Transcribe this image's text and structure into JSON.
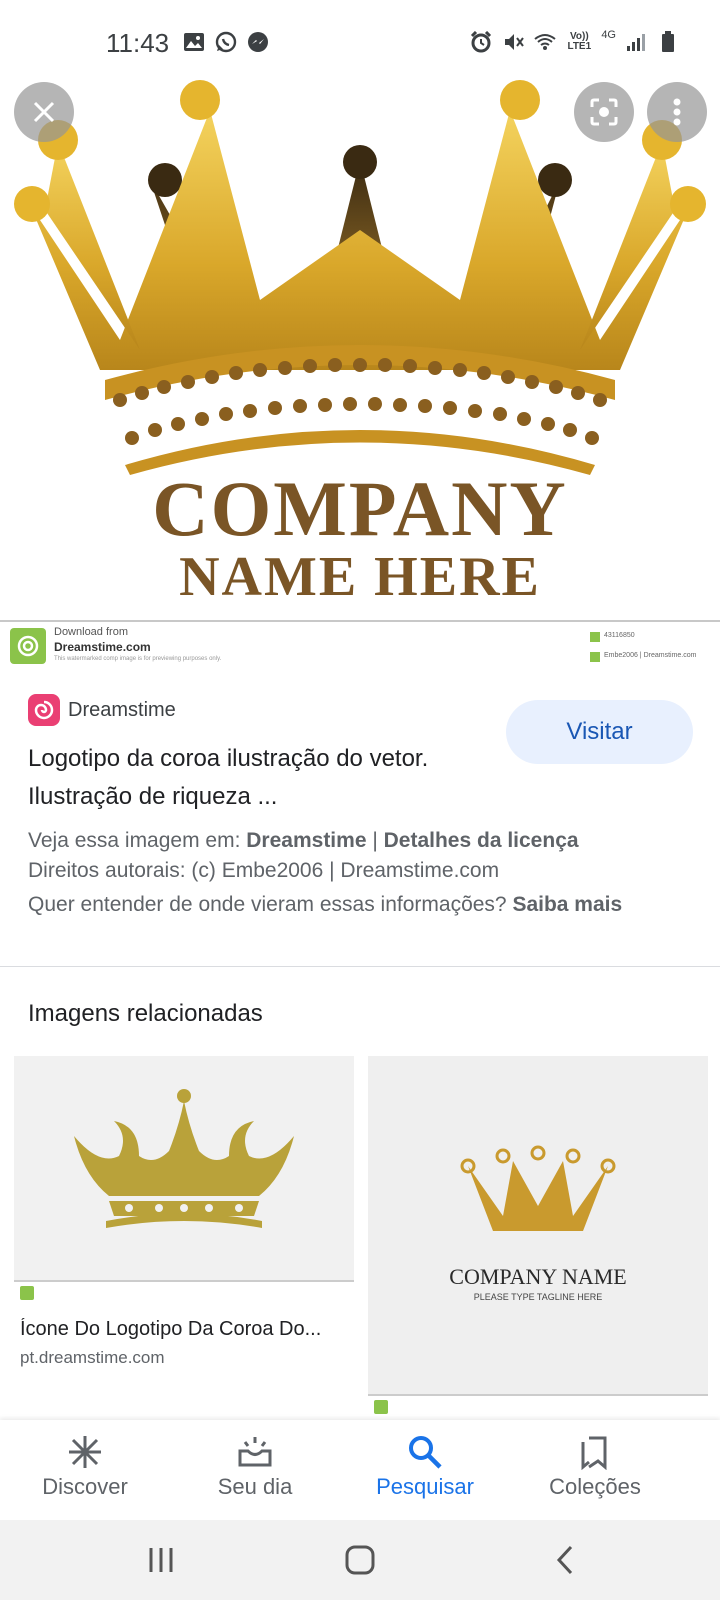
{
  "status_bar": {
    "time": "11:43",
    "volte_label": "Vo))",
    "lte_label": "LTE1",
    "network_label": "4G"
  },
  "hero": {
    "company_text": "COMPANY",
    "name_here_text": "NAME HERE",
    "watermark": {
      "line1": "Download from",
      "line2": "Dreamstime.com",
      "line3": "This watermarked comp image is for previewing purposes only.",
      "image_id": "43116850",
      "credit": "Embe2006 | Dreamstime.com"
    }
  },
  "result": {
    "source_name": "Dreamstime",
    "visit_label": "Visitar",
    "title": "Logotipo da coroa ilustração do vetor. Ilustração de riqueza ...",
    "see_image_prefix": "Veja essa imagem em: ",
    "see_image_link": "Dreamstime",
    "separator": " | ",
    "license_link": "Detalhes da licença",
    "copyright": "Direitos autorais: (c) Embe2006 | Dreamstime.com",
    "info_question": "Quer entender de onde vieram essas informações? ",
    "learn_more": "Saiba mais"
  },
  "related": {
    "heading": "Imagens relacionadas",
    "cards": [
      {
        "caption": "Ícone Do Logotipo Da Coroa Do...",
        "domain": "pt.dreamstime.com"
      },
      {
        "company_name": "COMPANY NAME",
        "tagline": "PLEASE TYPE TAGLINE HERE"
      }
    ]
  },
  "bottom_nav": {
    "items": [
      {
        "label": "Discover",
        "icon": "asterisk-icon"
      },
      {
        "label": "Seu dia",
        "icon": "sunrise-icon"
      },
      {
        "label": "Pesquisar",
        "icon": "search-icon",
        "active": true
      },
      {
        "label": "Coleções",
        "icon": "bookmarks-icon"
      }
    ]
  },
  "colors": {
    "accent": "#1a73e8",
    "visit_bg": "#e8f0fe",
    "crown_gold": "#d4a429",
    "crown_brown": "#6b4a1d",
    "dreamstime_pink": "#ea3f73"
  }
}
